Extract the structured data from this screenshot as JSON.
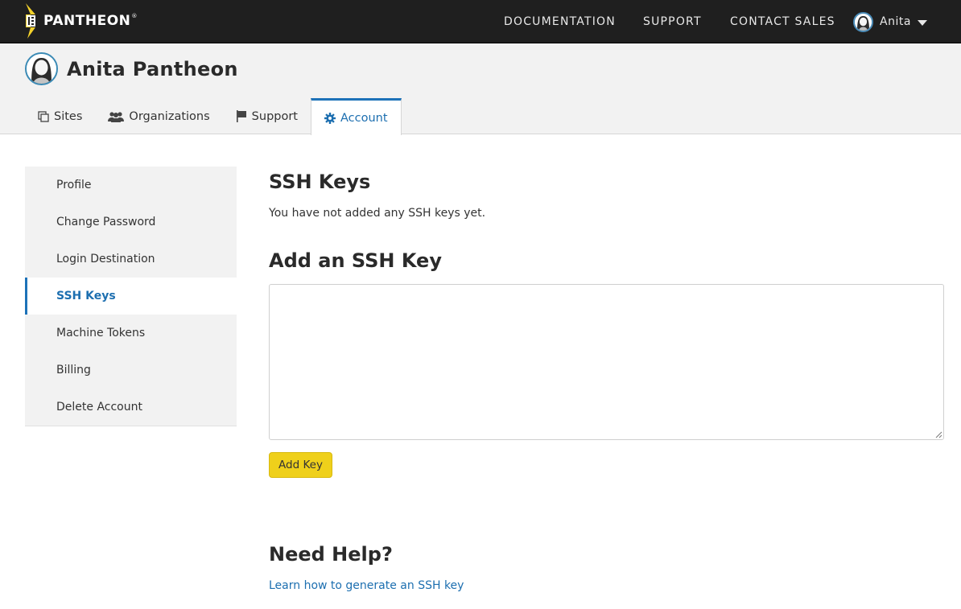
{
  "topbar": {
    "logo_text": "PANTHEON",
    "logo_reg": "®",
    "nav": [
      {
        "label": "DOCUMENTATION"
      },
      {
        "label": "SUPPORT"
      },
      {
        "label": "CONTACT SALES"
      }
    ],
    "user_name": "Anita"
  },
  "header": {
    "title": "Anita Pantheon",
    "tabs": [
      {
        "label": "Sites",
        "icon": "copy-icon"
      },
      {
        "label": "Organizations",
        "icon": "users-icon"
      },
      {
        "label": "Support",
        "icon": "flag-icon"
      },
      {
        "label": "Account",
        "icon": "gear-icon",
        "active": true
      }
    ]
  },
  "sidebar": {
    "items": [
      {
        "label": "Profile"
      },
      {
        "label": "Change Password"
      },
      {
        "label": "Login Destination"
      },
      {
        "label": "SSH Keys",
        "active": true
      },
      {
        "label": "Machine Tokens"
      },
      {
        "label": "Billing"
      },
      {
        "label": "Delete Account"
      }
    ]
  },
  "main": {
    "heading": "SSH Keys",
    "empty_message": "You have not added any SSH keys yet.",
    "add_heading": "Add an SSH Key",
    "key_input_value": "",
    "add_button": "Add Key",
    "help_heading": "Need Help?",
    "help_link": "Learn how to generate an SSH key"
  },
  "colors": {
    "topbar": "#1f1f1f",
    "accent": "#1d72b8",
    "button": "#efd01b",
    "logo_bolt": "#f3d12a"
  }
}
